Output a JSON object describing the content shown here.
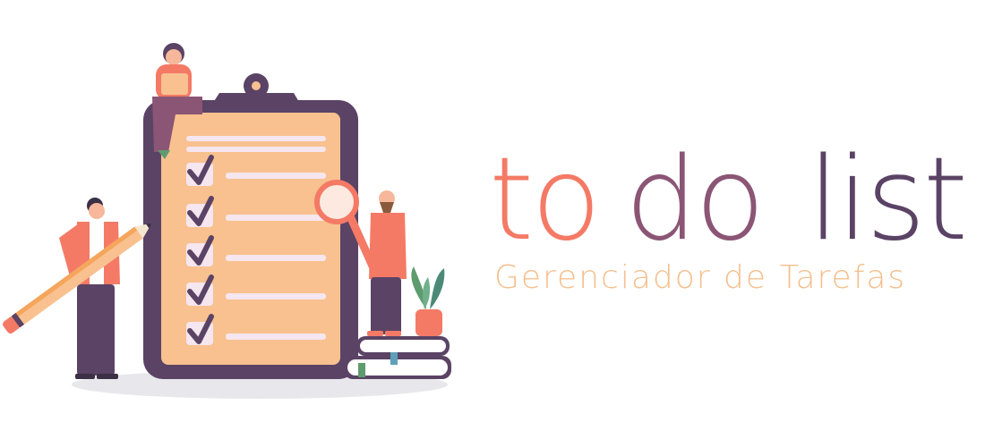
{
  "logo": {
    "word1": "to",
    "word2": "do",
    "word3": "list",
    "tagline": "Gerenciador de Tarefas"
  },
  "colors": {
    "to": "#f47a66",
    "do": "#8b5575",
    "list": "#5a4365",
    "tagline": "#f5bf8e",
    "clipboard_frame": "#5a4365",
    "clipboard_paper": "#f8c18f",
    "accent": "#f47a66"
  },
  "illustration": {
    "checklist_items_checked": 5,
    "icons": [
      "clipboard",
      "checkmark",
      "pencil",
      "magnifying-glass",
      "plant-pot",
      "books",
      "person-reading",
      "person-with-pencil",
      "person-with-magnifier"
    ]
  }
}
